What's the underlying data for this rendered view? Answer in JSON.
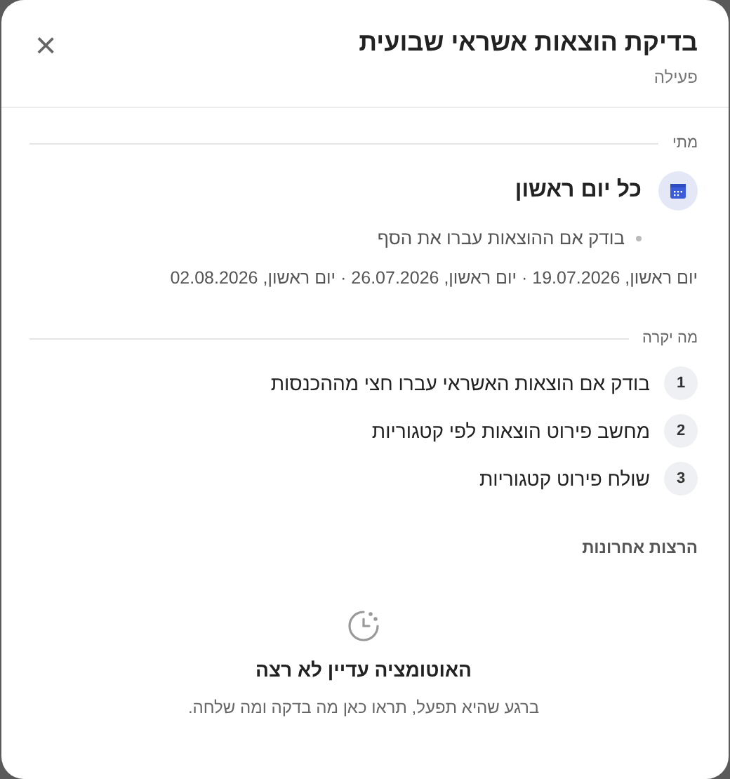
{
  "dialog": {
    "title": "בדיקת הוצאות אשראי שבועית",
    "status": "פעילה",
    "close": "×"
  },
  "when": {
    "label": "מתי",
    "schedule": "כל יום ראשון",
    "condition": "בודק אם ההוצאות עברו את הסף",
    "upcoming": "יום ראשון, 19.07.2026 · יום ראשון, 26.07.2026 · יום ראשון, 02.08.2026"
  },
  "steps": {
    "label": "מה יקרה",
    "items": [
      {
        "number": "1",
        "text": "בודק אם הוצאות האשראי עברו חצי מההכנסות"
      },
      {
        "number": "2",
        "text": "מחשב פירוט הוצאות לפי קטגוריות"
      },
      {
        "number": "3",
        "text": "שולח פירוט קטגוריות"
      }
    ]
  },
  "runs": {
    "label": "הרצות אחרונות",
    "empty_title": "האוטומציה עדיין לא רצה",
    "empty_text": "ברגע שהיא תפעל, תראו כאן מה בדקה ומה שלחה."
  }
}
